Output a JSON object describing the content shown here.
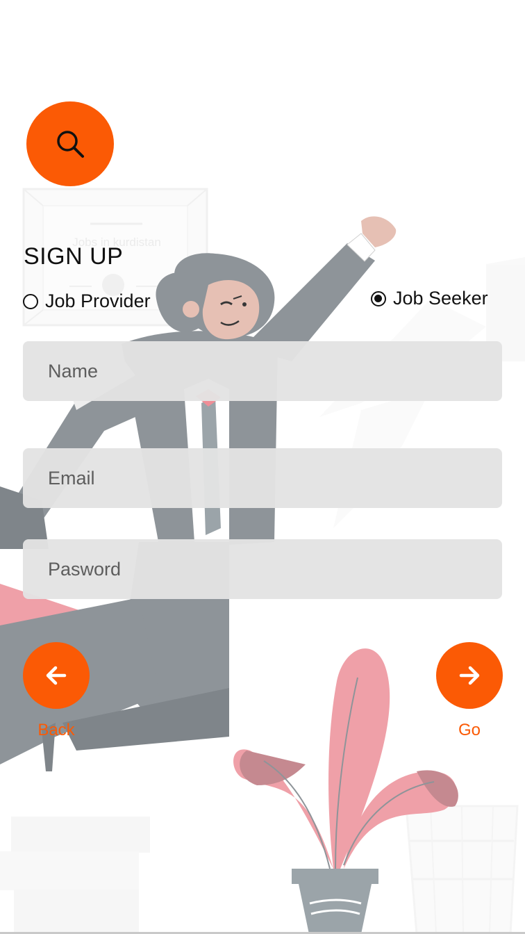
{
  "background": {
    "frame_text": "Jobs in kurdistan"
  },
  "search": {
    "icon": "search-icon",
    "color": "#fb5a05"
  },
  "form": {
    "title": "SIGN UP",
    "role_options": [
      {
        "label": "Job Provider",
        "selected": false
      },
      {
        "label": "Job Seeker",
        "selected": true
      }
    ],
    "name_placeholder": "Name",
    "email_placeholder": "Email",
    "password_placeholder": "Pasword"
  },
  "actions": {
    "back_label": "Back",
    "back_icon": "arrow-left-icon",
    "go_label": "Go",
    "go_icon": "arrow-right-icon"
  },
  "colors": {
    "accent": "#fb5a05",
    "field_bg": "#e3e3e3"
  }
}
